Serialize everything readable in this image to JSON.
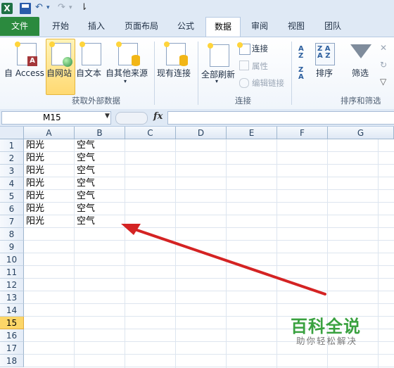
{
  "quick_access": {
    "logo": "X",
    "undo_glyph": "↶",
    "redo_glyph": "↷",
    "more_glyph": "▾",
    "customize_glyph": "⇂"
  },
  "tabs": [
    {
      "label": "文件",
      "active": false,
      "file": true
    },
    {
      "label": "开始",
      "active": false
    },
    {
      "label": "插入",
      "active": false
    },
    {
      "label": "页面布局",
      "active": false
    },
    {
      "label": "公式",
      "active": false
    },
    {
      "label": "数据",
      "active": true
    },
    {
      "label": "审阅",
      "active": false
    },
    {
      "label": "视图",
      "active": false
    },
    {
      "label": "团队",
      "active": false
    }
  ],
  "ribbon": {
    "get_external": {
      "buttons": [
        "自 Access",
        "自网站",
        "自文本",
        "自其他来源",
        "现有连接"
      ],
      "group_label": "获取外部数据"
    },
    "connections": {
      "refresh_all": "全部刷新",
      "connections": "连接",
      "properties": "属性",
      "edit_links": "编辑链接",
      "group_label": "连接"
    },
    "sort_filter": {
      "sort": "排序",
      "filter": "筛选",
      "group_label": "排序和筛选"
    }
  },
  "formula_bar": {
    "name_box": "M15",
    "fx": "fx",
    "formula": ""
  },
  "grid": {
    "columns": [
      "A",
      "B",
      "C",
      "D",
      "E",
      "F",
      "G"
    ],
    "rows": [
      "1",
      "2",
      "3",
      "4",
      "5",
      "6",
      "7",
      "8",
      "9",
      "10",
      "11",
      "12",
      "13",
      "14",
      "15",
      "16",
      "17",
      "18"
    ],
    "selected_row": "15",
    "cells": [
      [
        "阳光",
        "空气"
      ],
      [
        "阳光",
        "空气"
      ],
      [
        "阳光",
        "空气"
      ],
      [
        "阳光",
        "空气"
      ],
      [
        "阳光",
        "空气"
      ],
      [
        "阳光",
        "空气"
      ],
      [
        "阳光",
        "空气"
      ]
    ]
  },
  "colors": {
    "file_tab": "#2b8a3e",
    "arrow": "#d42323",
    "watermark": "#39a13f",
    "selected_row": "#fcd668"
  }
}
